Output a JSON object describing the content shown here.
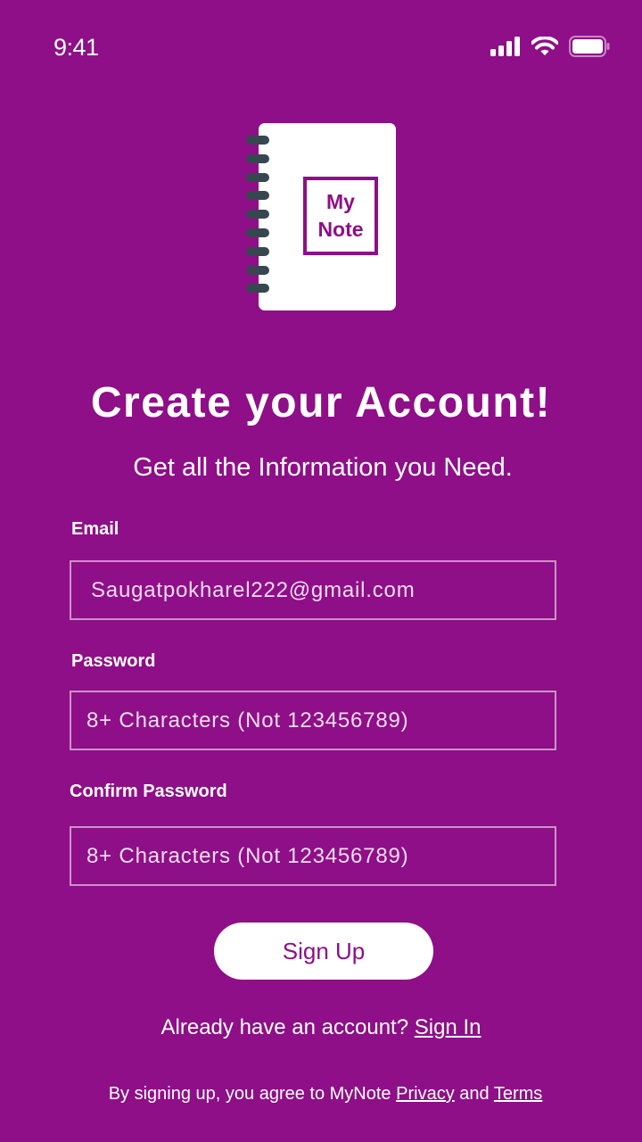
{
  "status_bar": {
    "time": "9:41",
    "icons": [
      "cellular-signal-icon",
      "wifi-icon",
      "battery-icon"
    ]
  },
  "logo": {
    "line1": "My",
    "line2": "Note",
    "icon": "spiral-notebook-icon"
  },
  "header": {
    "title": "Create your Account!",
    "subtitle": "Get all the Information you Need."
  },
  "form": {
    "email": {
      "label": "Email",
      "value": "Saugatpokharel222@gmail.com",
      "placeholder": ""
    },
    "password": {
      "label": "Password",
      "value": "",
      "placeholder": "8+ Characters (Not 123456789)"
    },
    "confirm_password": {
      "label": "Confirm Password",
      "value": "",
      "placeholder": "8+ Characters (Not 123456789)"
    },
    "submit_label": "Sign Up"
  },
  "footer": {
    "have_account_text": "Already have an account?",
    "sign_in_label": "Sign In",
    "agree_text": "By signing up, you agree to MyNote",
    "privacy_label": "Privacy",
    "and_text": "and",
    "terms_label": "Terms"
  },
  "colors": {
    "background": "#8e0f87",
    "button_background": "#ffffff",
    "button_text": "#8e0f87",
    "notebook_rings": "#37474f"
  }
}
